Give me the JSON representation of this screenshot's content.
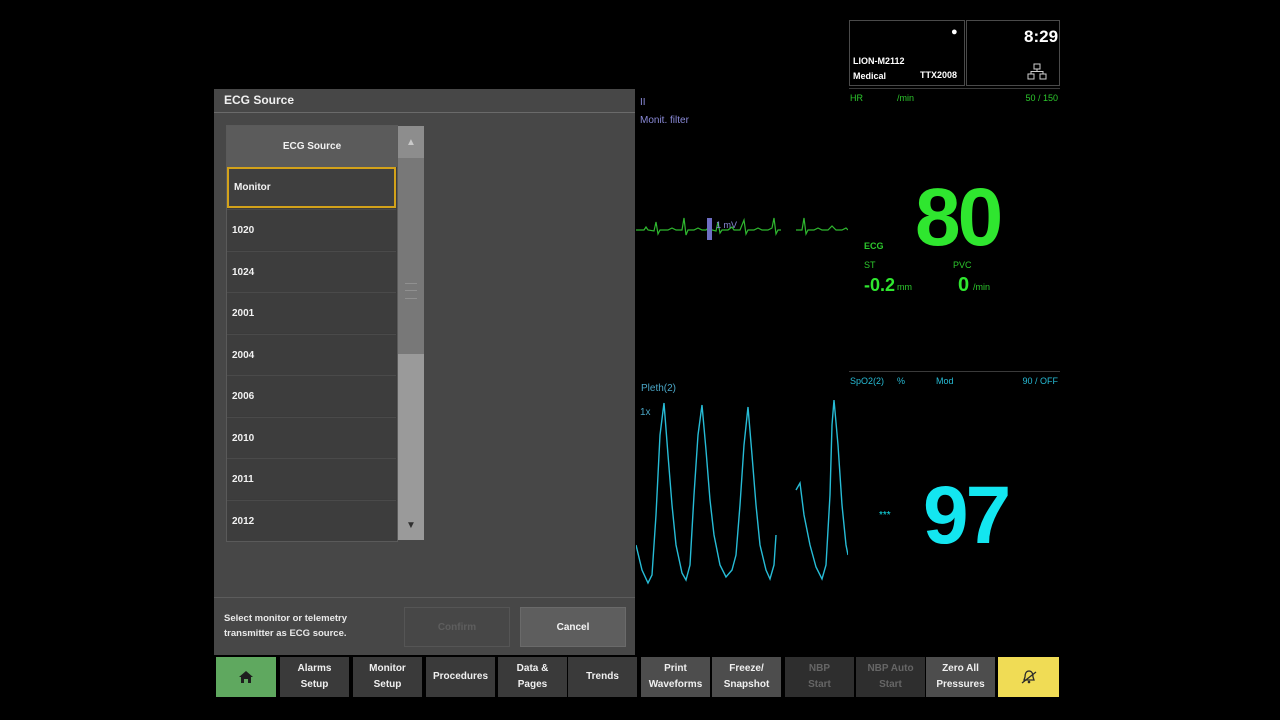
{
  "dialog": {
    "title": "ECG Source",
    "list_header": "ECG Source",
    "items": [
      "Monitor",
      "1020",
      "1024",
      "2001",
      "2004",
      "2006",
      "2010",
      "2011",
      "2012"
    ],
    "selected": "Monitor",
    "helper_text": "Select monitor or telemetry transmitter as ECG source.",
    "confirm_label": "Confirm",
    "cancel_label": "Cancel"
  },
  "ecg_wave": {
    "lead": "II",
    "filter": "Monit. filter",
    "scale": "1 mV",
    "color": "#2fb82f"
  },
  "pleth_wave": {
    "label": "Pleth(2)",
    "scale": "1x",
    "color": "#27bcd6"
  },
  "patient": {
    "id": "LION-M2112",
    "department": "Medical",
    "transmitter": "TTX2008",
    "icon": "person-icon"
  },
  "clock": {
    "time": "8:29",
    "icon": "network-icon"
  },
  "hr": {
    "label": "HR",
    "unit": "/min",
    "limits": "50 / 150",
    "value": "80",
    "source_tag": "ECG",
    "st_label": "ST",
    "st_value": "-0.2",
    "st_unit": "mm",
    "pvc_label": "PVC",
    "pvc_value": "0",
    "pvc_unit": "/min",
    "color": "#2fe62f"
  },
  "spo2": {
    "label": "SpO2(2)",
    "unit": "%",
    "mode": "Mod",
    "limits": "90 / OFF",
    "value": "97",
    "perfusion": "***",
    "color": "#13e6f0"
  },
  "toolbar": {
    "home_icon": "home-icon",
    "buttons": [
      {
        "label": "Alarms\nSetup",
        "enabled": true
      },
      {
        "label": "Monitor\nSetup",
        "enabled": true
      },
      {
        "label": "Procedures",
        "enabled": true
      },
      {
        "label": "Data &\nPages",
        "enabled": true
      },
      {
        "label": "Trends",
        "enabled": true
      },
      {
        "label": "Print\nWaveforms",
        "enabled": true
      },
      {
        "label": "Freeze/\nSnapshot",
        "enabled": true
      },
      {
        "label": "NBP\nStart",
        "enabled": false
      },
      {
        "label": "NBP Auto\nStart",
        "enabled": false
      },
      {
        "label": "Zero All\nPressures",
        "enabled": true
      }
    ],
    "alarm_silence_icon": "alarm-silence-icon"
  }
}
